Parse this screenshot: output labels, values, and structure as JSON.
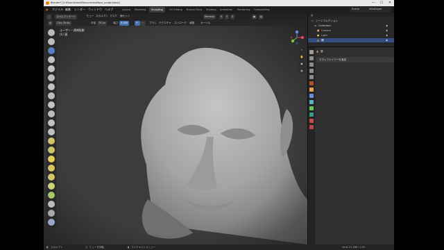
{
  "window": {
    "title": "Blender* [C:¥Users¥user¥Documents¥face_sculpt.blend]",
    "min": "—",
    "max": "☐",
    "close": "✕"
  },
  "menubar": {
    "menus": [
      "ファイル",
      "編集",
      "レンダー",
      "ウィンドウ",
      "ヘルプ"
    ],
    "workspaces": [
      "Layout",
      "Modeling",
      "Sculpting",
      "UV Editing",
      "Texture Paint",
      "Shading",
      "Animation",
      "Rendering",
      "Compositing"
    ],
    "active_workspace": "Sculpting",
    "scene": "Scene",
    "view_layer": "ViewLayer"
  },
  "header": {
    "mode": "スカルプトモード",
    "view_menus": [
      "ビュー",
      "スカルプト",
      "マスク",
      "面セット"
    ],
    "brush": "Clay Strips",
    "radius_label": "半径",
    "radius": "76 px",
    "strength_label": "強さ",
    "strength": "0.500",
    "direction_add": "＋",
    "direction_sub": "－",
    "options": [
      "ブラシ",
      "テクスチャ",
      "ストローク",
      "減衰",
      "カーソル"
    ],
    "remesh": "Remesh",
    "symmetry": [
      "X",
      "Y",
      "Z"
    ]
  },
  "viewport": {
    "view_label": "ユーザー・透視投影",
    "object_label": "(1) 頭"
  },
  "outliner": {
    "root": "シーンコレクション",
    "rows": [
      {
        "label": "Collection",
        "icon_color": "#e6e6e6"
      },
      {
        "label": "Camera",
        "icon_color": "#ff9d6e"
      },
      {
        "label": "Light",
        "icon_color": "#ffd45a"
      },
      {
        "label": "頭",
        "icon_color": "#ff9a3c",
        "selected": true
      }
    ]
  },
  "properties": {
    "object_name": "頭",
    "section": "モディファイアーを追加"
  },
  "statusbar": {
    "items": [
      "スカルプト",
      "ビューを回転",
      "コンテキストメニュー"
    ],
    "version": "Verts 24,586 | 2.93"
  },
  "colors": {
    "accent": "#4772b3",
    "selected_row": "#334d80",
    "logo": "#e87d0d"
  }
}
